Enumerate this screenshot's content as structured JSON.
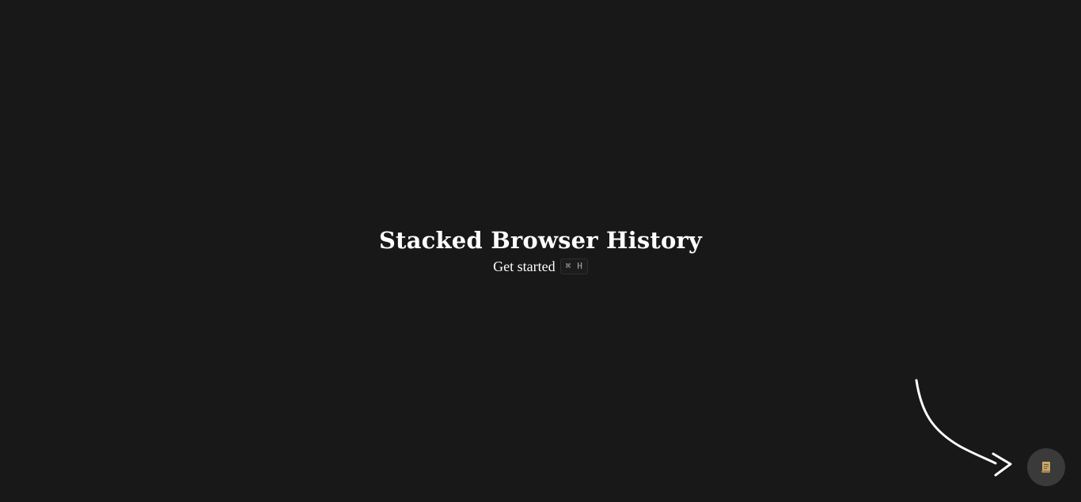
{
  "hero": {
    "title": "Stacked Browser History",
    "subtitle": "Get started",
    "shortcut": {
      "modifier": "⌘",
      "key": "H"
    }
  },
  "fab": {
    "icon": "scroll-icon",
    "accent_color": "#c9a96b"
  },
  "colors": {
    "background": "#181818",
    "text": "#ffffff",
    "fab_background": "#3a3a3a"
  }
}
